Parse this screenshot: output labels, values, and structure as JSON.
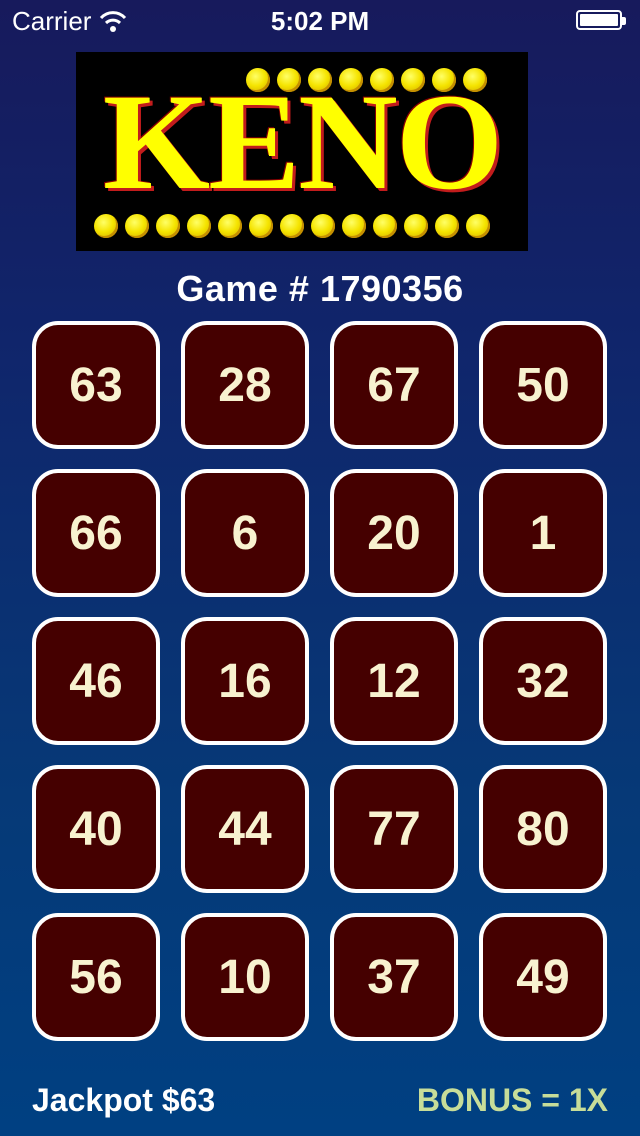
{
  "status_bar": {
    "carrier": "Carrier",
    "time": "5:02 PM",
    "wifi_icon": "wifi-icon",
    "battery_icon": "battery-icon"
  },
  "logo": {
    "text": "KENO"
  },
  "game": {
    "label": "Game # 1790356"
  },
  "grid": {
    "numbers": [
      "63",
      "28",
      "67",
      "50",
      "66",
      "6",
      "20",
      "1",
      "46",
      "16",
      "12",
      "32",
      "40",
      "44",
      "77",
      "80",
      "56",
      "10",
      "37",
      "49"
    ]
  },
  "footer": {
    "jackpot": "Jackpot $63",
    "bonus": "BONUS = 1X"
  },
  "colors": {
    "tile_fill": "#450000",
    "tile_border": "#ffffff",
    "tile_text": "#f8f2d0",
    "bonus_text": "#c7dd99",
    "logo_yellow": "#ffff00"
  }
}
